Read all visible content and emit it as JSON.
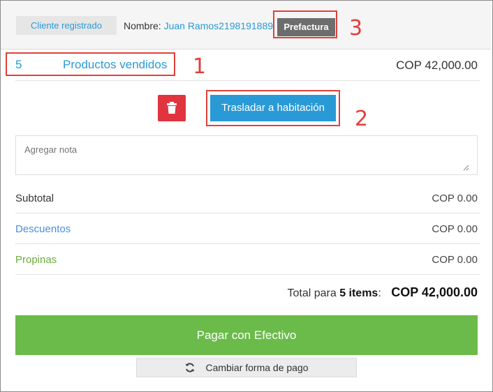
{
  "header": {
    "client_button": "Cliente registrado",
    "name_label": "Nombre:",
    "name_value": "Juan Ramos2198191889",
    "prefactura_button": "Prefactura"
  },
  "products": {
    "count": "5",
    "label": "Productos vendidos",
    "total": "COP 42,000.00"
  },
  "actions": {
    "delete_icon": "trash-icon",
    "transfer_button": "Trasladar a habitación"
  },
  "note": {
    "placeholder": "Agregar nota"
  },
  "summary": {
    "subtotal_label": "Subtotal",
    "subtotal_value": "COP 0.00",
    "discounts_label": "Descuentos",
    "discounts_value": "COP 0.00",
    "tips_label": "Propinas",
    "tips_value": "COP 0.00"
  },
  "total": {
    "prefix": "Total para",
    "items": "5 items",
    "suffix": ":",
    "amount": "COP 42,000.00"
  },
  "payment": {
    "pay_button": "Pagar con Efectivo",
    "change_button": "Cambiar forma de pago",
    "change_icon": "refresh-icon"
  },
  "annotations": {
    "marker_1": "1",
    "marker_2": "2",
    "marker_3": "3",
    "highlight_color": "#e0403a"
  },
  "colors": {
    "accent_blue": "#2a9ad6",
    "danger_red": "#e0343f",
    "success_green": "#6abb4a",
    "tips_green": "#6aad3d"
  }
}
